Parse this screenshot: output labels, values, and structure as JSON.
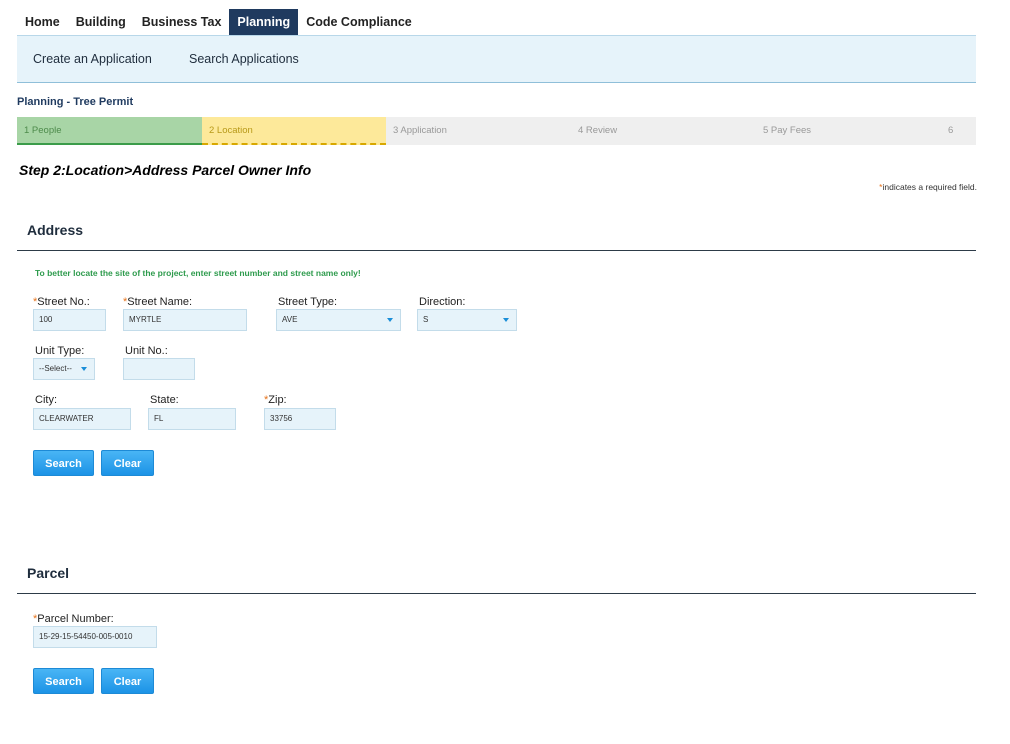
{
  "nav": {
    "tabs": [
      "Home",
      "Building",
      "Business Tax",
      "Planning",
      "Code Compliance"
    ],
    "active": "Planning",
    "sub": [
      "Create an Application",
      "Search Applications"
    ]
  },
  "page_title": "Planning - Tree Permit",
  "progress": {
    "steps": [
      {
        "label": "1  People",
        "state": "done"
      },
      {
        "label": "2  Location",
        "state": "current"
      },
      {
        "label": "3  Application",
        "state": "todo"
      },
      {
        "label": "4  Review",
        "state": "todo"
      },
      {
        "label": "5  Pay Fees",
        "state": "todo"
      },
      {
        "label": "6",
        "state": "todo"
      }
    ]
  },
  "step_heading": "Step 2:Location>Address Parcel Owner Info",
  "required_note": {
    "star": "*",
    "text": "indicates a required field."
  },
  "address": {
    "title": "Address",
    "hint": "To better locate the site of the project, enter street number and street name only!",
    "street_no": {
      "label": "Street No.:",
      "value": "100",
      "required": true
    },
    "street_name": {
      "label": "Street Name:",
      "value": "MYRTLE",
      "required": true
    },
    "street_type": {
      "label": "Street Type:",
      "value": "AVE"
    },
    "direction": {
      "label": "Direction:",
      "value": "S"
    },
    "unit_type": {
      "label": "Unit Type:",
      "value": "--Select--"
    },
    "unit_no": {
      "label": "Unit No.:",
      "value": ""
    },
    "city": {
      "label": "City:",
      "value": "CLEARWATER"
    },
    "state": {
      "label": "State:",
      "value": "FL"
    },
    "zip": {
      "label": "Zip:",
      "value": "33756",
      "required": true
    },
    "search_label": "Search",
    "clear_label": "Clear"
  },
  "parcel": {
    "title": "Parcel",
    "parcel_number": {
      "label": "Parcel Number:",
      "value": "15-29-15-54450-005-0010",
      "required": true
    },
    "search_label": "Search",
    "clear_label": "Clear"
  },
  "colors": {
    "nav_active": "#1f3a5f",
    "subnav_bg": "#e6f3fa",
    "step_done": "#a8d5a6",
    "step_current": "#fde99a",
    "hint_green": "#2e9b4d",
    "required_star": "#e6721a",
    "button_blue": "#2a9ff0"
  }
}
